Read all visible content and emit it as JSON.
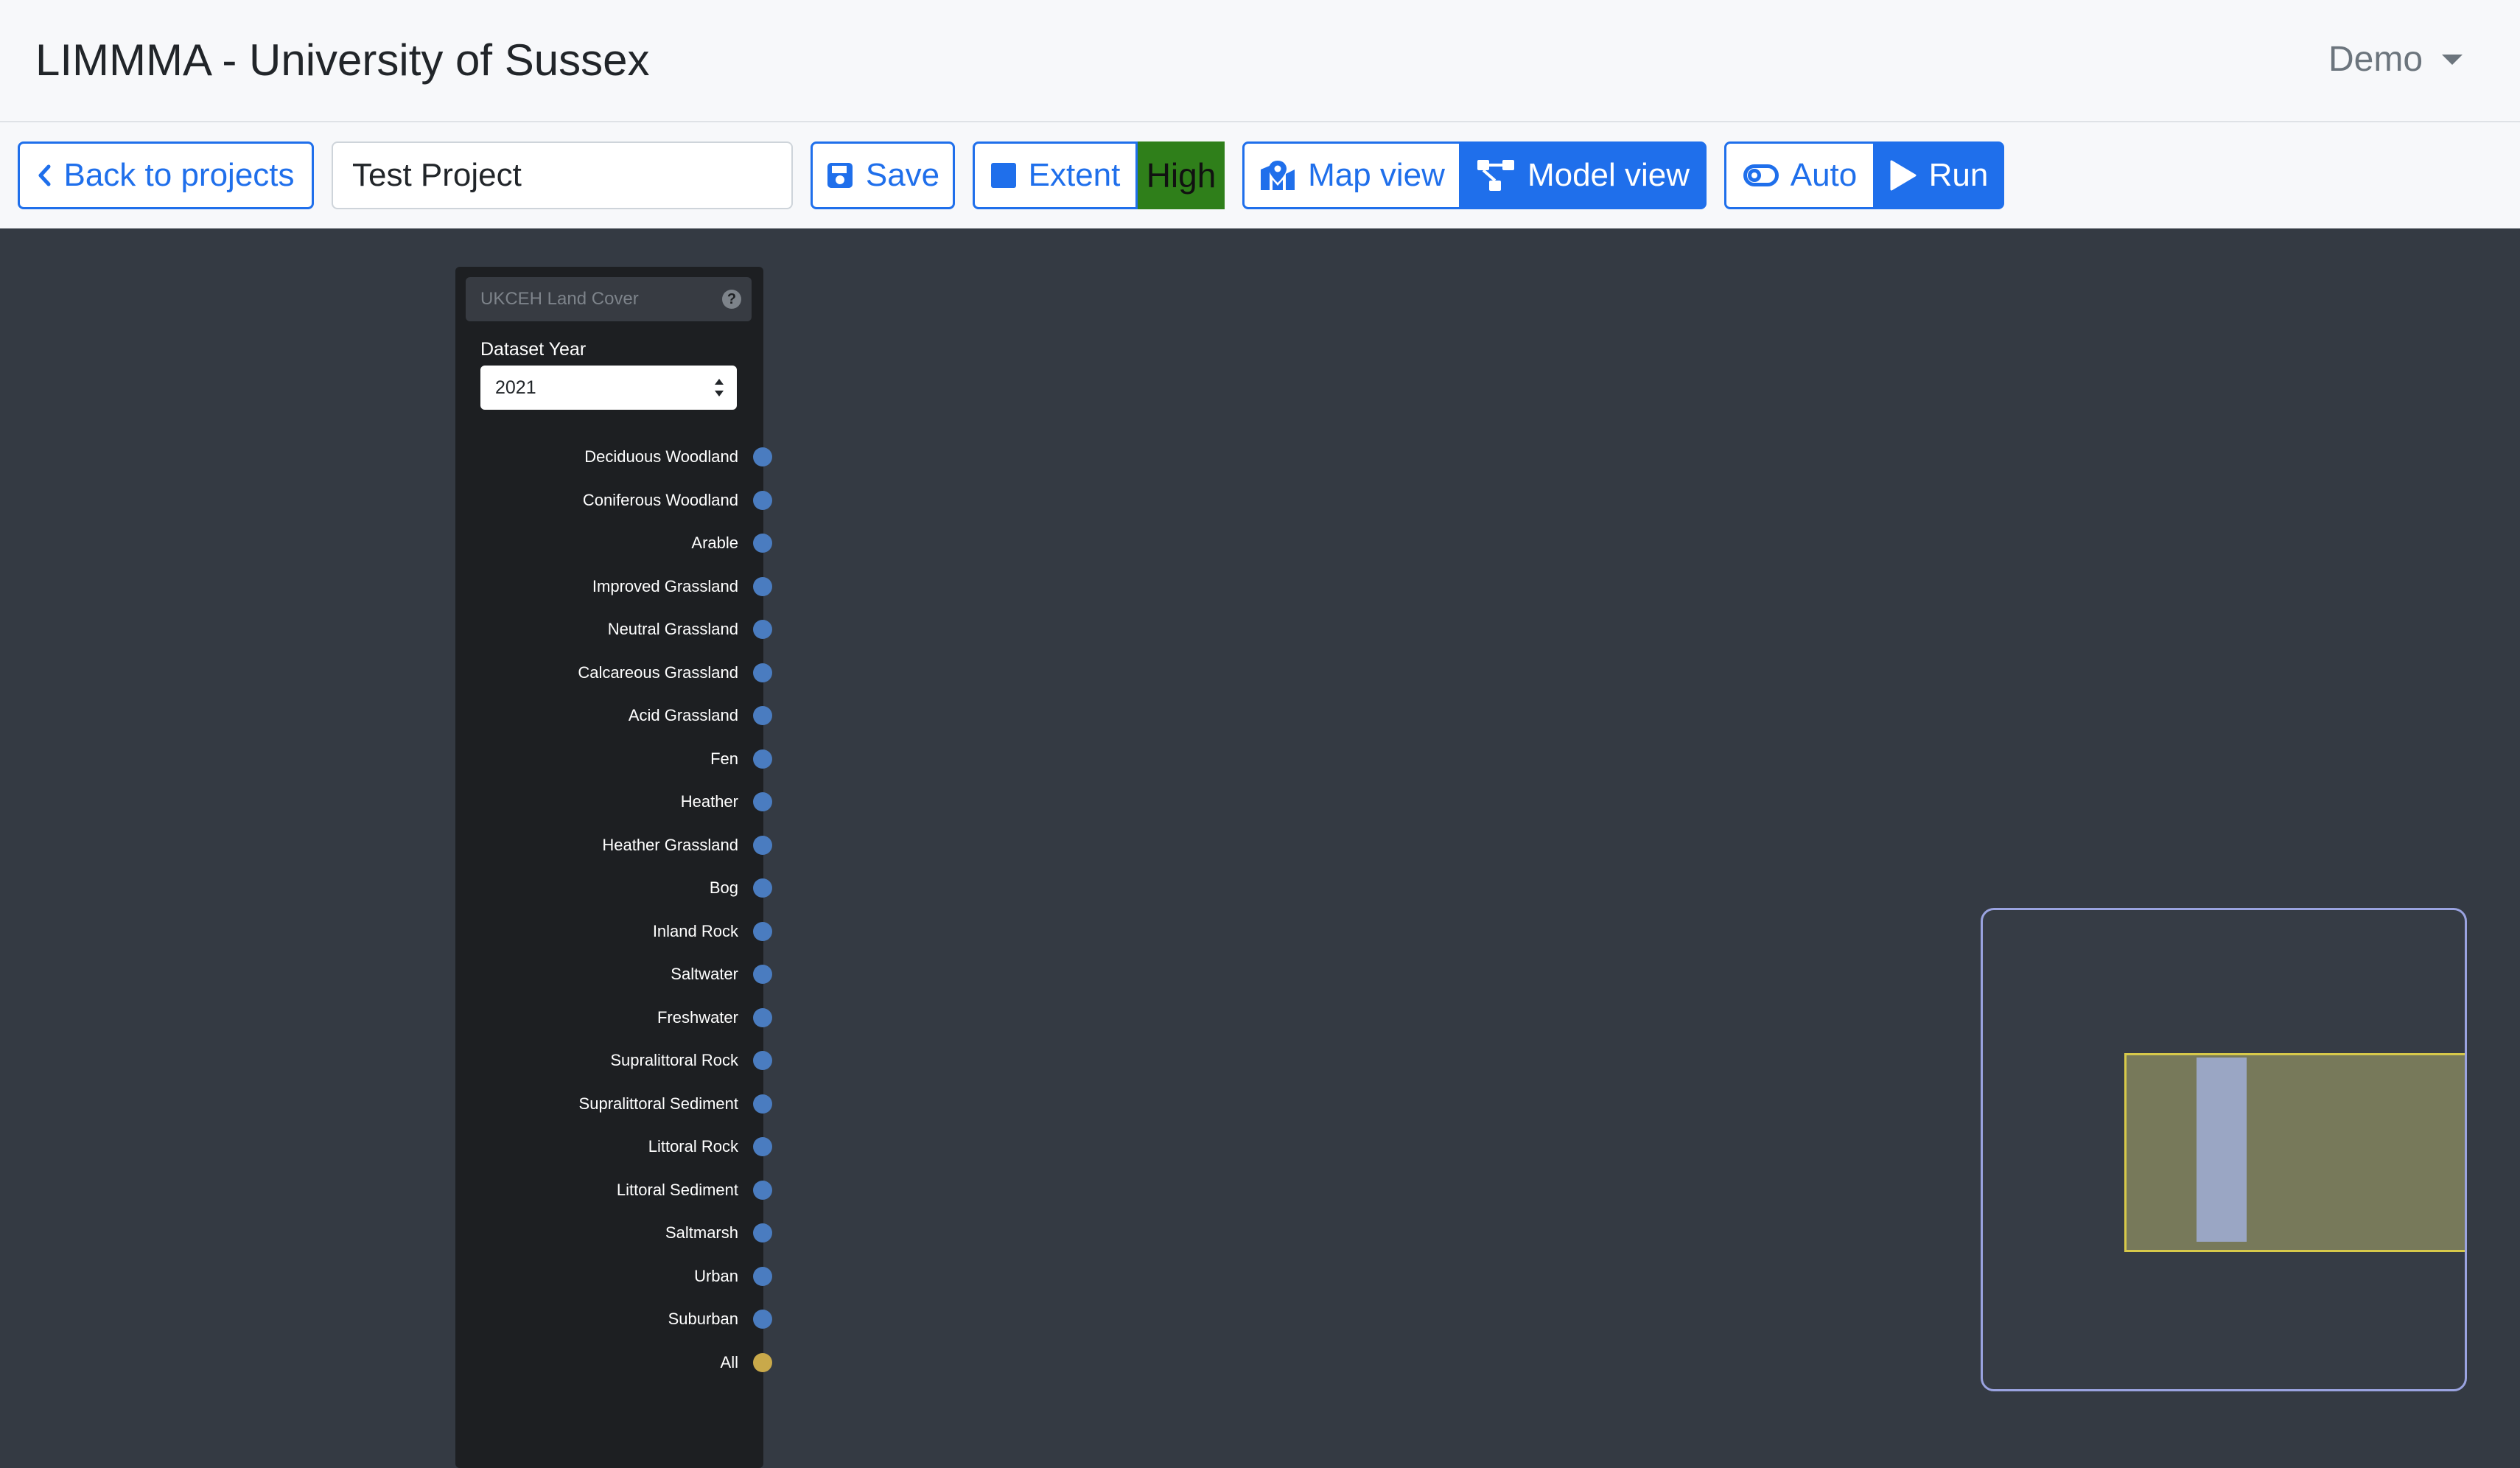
{
  "app": {
    "title": "LIMMMA - University of Sussex",
    "user_menu_label": "Demo"
  },
  "toolbar": {
    "back_label": "Back to projects",
    "project_name": "Test Project",
    "save_label": "Save",
    "extent_label": "Extent",
    "extent_resolution_badge": "High",
    "map_view_label": "Map view",
    "model_view_label": "Model view",
    "auto_label": "Auto",
    "run_label": "Run",
    "active_view": "Model view"
  },
  "node": {
    "title": "UKCEH Land Cover",
    "dataset_year_label": "Dataset Year",
    "dataset_year_value": "2021",
    "outputs": [
      {
        "label": "Deciduous Woodland",
        "type": "single"
      },
      {
        "label": "Coniferous Woodland",
        "type": "single"
      },
      {
        "label": "Arable",
        "type": "single"
      },
      {
        "label": "Improved Grassland",
        "type": "single"
      },
      {
        "label": "Neutral Grassland",
        "type": "single"
      },
      {
        "label": "Calcareous Grassland",
        "type": "single"
      },
      {
        "label": "Acid Grassland",
        "type": "single"
      },
      {
        "label": "Fen",
        "type": "single"
      },
      {
        "label": "Heather",
        "type": "single"
      },
      {
        "label": "Heather Grassland",
        "type": "single"
      },
      {
        "label": "Bog",
        "type": "single"
      },
      {
        "label": "Inland Rock",
        "type": "single"
      },
      {
        "label": "Saltwater",
        "type": "single"
      },
      {
        "label": "Freshwater",
        "type": "single"
      },
      {
        "label": "Supralittoral Rock",
        "type": "single"
      },
      {
        "label": "Supralittoral Sediment",
        "type": "single"
      },
      {
        "label": "Littoral Rock",
        "type": "single"
      },
      {
        "label": "Littoral Sediment",
        "type": "single"
      },
      {
        "label": "Saltmarsh",
        "type": "single"
      },
      {
        "label": "Urban",
        "type": "single"
      },
      {
        "label": "Suburban",
        "type": "single"
      },
      {
        "label": "All",
        "type": "all"
      }
    ]
  },
  "colors": {
    "primary": "#1f6feb",
    "high_badge": "#2f7f1a",
    "canvas": "#343a43",
    "socket_single": "#4a7cc0",
    "socket_all": "#c9a94a",
    "minimap_border": "#9aa3e0",
    "minimap_viewport_border": "#d7c94a"
  },
  "icons": {
    "back": "chevron-left-icon",
    "save": "floppy-disk-icon",
    "extent": "square-icon",
    "map_view": "map-location-icon",
    "model_view": "diagram-project-icon",
    "auto": "toggle-icon",
    "run": "play-icon",
    "help": "question-circle-icon",
    "user_menu": "caret-down-icon"
  }
}
